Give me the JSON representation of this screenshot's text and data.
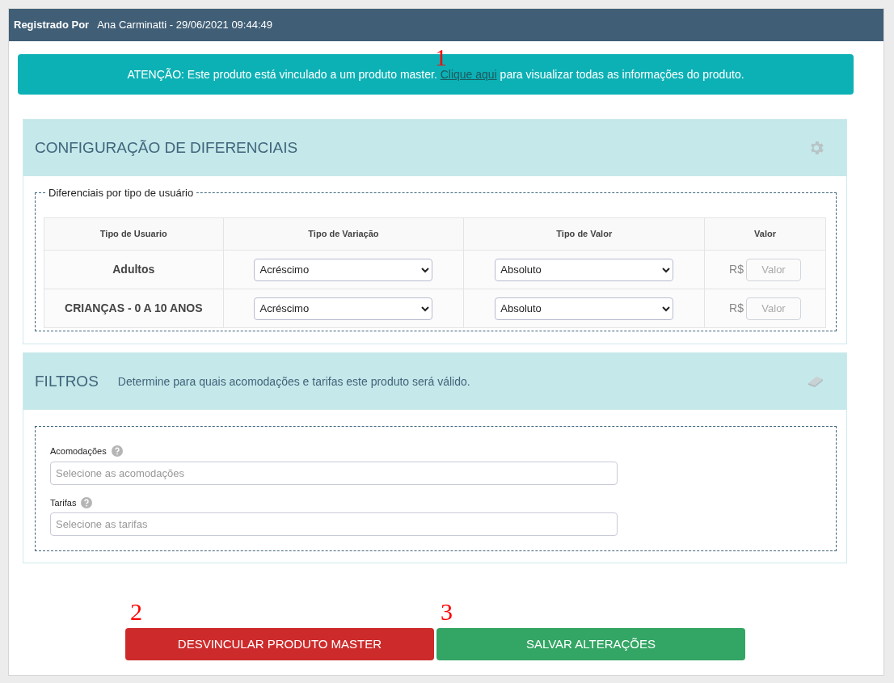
{
  "header": {
    "label": "Registrado Por",
    "value": "Ana Carminatti - 29/06/2021 09:44:49"
  },
  "alert": {
    "text": "ATENÇÃO: Este produto está vinculado a um produto master.",
    "link": "Clique aqui",
    "after": "para visualizar todas as informações do produto."
  },
  "differentials": {
    "title": "CONFIGURAÇÃO DE DIFERENCIAIS",
    "legend": "Diferenciais por tipo de usuário",
    "columns": [
      "Tipo de Usuario",
      "Tipo de Variação",
      "Tipo de Valor",
      "Valor"
    ],
    "rows": [
      {
        "user_type": "Adultos",
        "variation": "Acréscimo",
        "value_type": "Absoluto",
        "currency": "R$",
        "value_placeholder": "Valor"
      },
      {
        "user_type": "CRIANÇAS - 0 A 10 ANOS",
        "variation": "Acréscimo",
        "value_type": "Absoluto",
        "currency": "R$",
        "value_placeholder": "Valor"
      }
    ]
  },
  "filters": {
    "title": "FILTROS",
    "subtitle": "Determine para quais acomodações e tarifas este produto será válido.",
    "fields": [
      {
        "label": "Acomodações",
        "placeholder": "Selecione as acomodações"
      },
      {
        "label": "Tarifas",
        "placeholder": "Selecione as tarifas"
      }
    ]
  },
  "buttons": [
    {
      "kind": "danger",
      "label": "DESVINCULAR PRODUTO MASTER"
    },
    {
      "kind": "success",
      "label": "SALVAR ALTERAÇÕES"
    }
  ],
  "annotations": [
    "1",
    "2",
    "3"
  ]
}
